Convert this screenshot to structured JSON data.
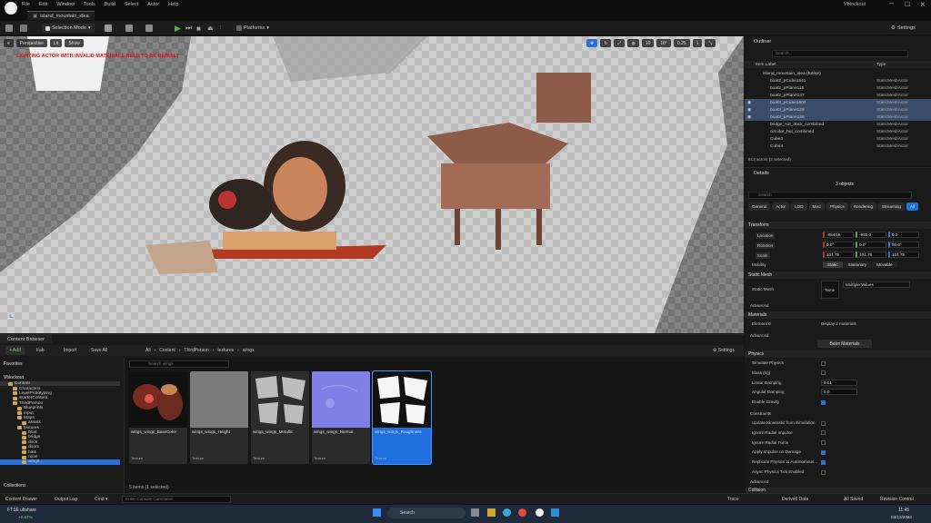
{
  "window": {
    "menu": [
      "File",
      "Edit",
      "Window",
      "Tools",
      "Build",
      "Select",
      "Actor",
      "Help"
    ],
    "tab_title": "island_mountain_idea",
    "project": "Vblockout",
    "min": "─",
    "max": "☐",
    "close": "✕"
  },
  "toolbar": {
    "mode": "Selection Mode",
    "platforms": "Platforms",
    "settings": "Settings"
  },
  "viewport": {
    "perspective": "Perspective",
    "lit": "Lit",
    "show": "Show",
    "warning": "LIGHTING ACTOR WITH INVALID MATERIALS NEED TO BE REBUILT",
    "grid": "10",
    "angle": "10°",
    "scale": "0.25",
    "speed": "1"
  },
  "content_browser": {
    "tab": "Content Browser",
    "add": "+ Add",
    "fab": "Fab",
    "import": "Import",
    "save_all": "Save All",
    "path": [
      "All",
      "Content",
      "ThirdPerson",
      "textures",
      "wings"
    ],
    "settings": "Settings",
    "favorites": "Favorites",
    "project_root": "Vblockout",
    "search_placeholder": "Search wings",
    "tree": [
      {
        "label": "Content",
        "depth": 1
      },
      {
        "label": "Characters",
        "depth": 2
      },
      {
        "label": "LevelPrototyping",
        "depth": 2
      },
      {
        "label": "StarterContent",
        "depth": 2
      },
      {
        "label": "ThirdPerson",
        "depth": 2
      },
      {
        "label": "Blueprints",
        "depth": 3
      },
      {
        "label": "Input",
        "depth": 3
      },
      {
        "label": "Maps",
        "depth": 3
      },
      {
        "label": "assets",
        "depth": 4
      },
      {
        "label": "textures",
        "depth": 3
      },
      {
        "label": "boat",
        "depth": 4
      },
      {
        "label": "bridge",
        "depth": 4
      },
      {
        "label": "dock",
        "depth": 4
      },
      {
        "label": "doors",
        "depth": 4
      },
      {
        "label": "hats",
        "depth": 4
      },
      {
        "label": "ruins",
        "depth": 4
      },
      {
        "label": "wings",
        "depth": 4
      }
    ],
    "collections": "Collections",
    "items": [
      {
        "name": "wings_wings_BaseColor",
        "type": "Texture",
        "thumb": "basecolor"
      },
      {
        "name": "wings_wings_Height",
        "type": "Texture",
        "thumb": "height"
      },
      {
        "name": "wings_wings_Metallic",
        "type": "Texture",
        "thumb": "metallic"
      },
      {
        "name": "wings_wings_Normal",
        "type": "Texture",
        "thumb": "normal"
      },
      {
        "name": "wings_wings_Roughness",
        "type": "Texture",
        "thumb": "roughness"
      }
    ],
    "count": "5 items (1 selected)"
  },
  "outliner": {
    "title": "Outliner",
    "search_placeholder": "Search...",
    "col_label": "Item Label",
    "col_type": "Type",
    "rows": [
      {
        "label": "island_mountain_idea (Editor)",
        "type": "",
        "selected": false,
        "indent": 1
      },
      {
        "label": "boat2_pCube1541",
        "type": "StaticMeshActor",
        "selected": false,
        "indent": 2
      },
      {
        "label": "boat2_pPlane115",
        "type": "StaticMeshActor",
        "selected": false,
        "indent": 2
      },
      {
        "label": "boat2_pPlane147",
        "type": "StaticMeshActor",
        "selected": false,
        "indent": 2
      },
      {
        "label": "boat3_pCube1604",
        "type": "StaticMeshActor",
        "selected": true,
        "indent": 2
      },
      {
        "label": "boat3_pPlane128",
        "type": "StaticMeshActor",
        "selected": true,
        "indent": 2
      },
      {
        "label": "boat3_pPlane148",
        "type": "StaticMeshActor",
        "selected": true,
        "indent": 2
      },
      {
        "label": "bridge_not_dock_combined",
        "type": "StaticMeshActor",
        "selected": false,
        "indent": 2
      },
      {
        "label": "circular_hut_combined",
        "type": "StaticMeshActor",
        "selected": false,
        "indent": 2
      },
      {
        "label": "Cube3",
        "type": "StaticMeshActor",
        "selected": false,
        "indent": 2
      },
      {
        "label": "Cube4",
        "type": "StaticMeshActor",
        "selected": false,
        "indent": 2
      }
    ],
    "footer": "913 actors (3 selected)"
  },
  "details": {
    "title": "Details",
    "objects": "3 objects",
    "search_placeholder": "Search",
    "tabs": [
      "General",
      "Actor",
      "LOD",
      "Misc",
      "Physics",
      "Rendering",
      "Streaming",
      "All"
    ],
    "transform": "Transform",
    "location": {
      "label": "Location",
      "x": "-8840.6",
      "y": "-980.0",
      "z": "0.0"
    },
    "rotation": {
      "label": "Rotation",
      "x": "0.0°",
      "y": "0.0°",
      "z": "90.0°"
    },
    "scale": {
      "label": "Scale",
      "x": "101.75",
      "y": "101.75",
      "z": "101.75"
    },
    "mobility": {
      "label": "Mobility",
      "options": [
        "Static",
        "Stationary",
        "Movable"
      ]
    },
    "static_mesh_section": "Static Mesh",
    "static_mesh_label": "Static Mesh",
    "mesh_none": "None",
    "mesh_value": "Multiple Values",
    "advanced": "Advanced",
    "materials_section": "Materials",
    "element": "Element 0",
    "element_value": "Display 2 materials",
    "bake": "Bake Materials",
    "physics_section": "Physics",
    "physics": [
      {
        "label": "Simulate Physics",
        "on": false
      },
      {
        "label": "Mass (kg)",
        "on": false
      },
      {
        "label": "Linear Damping",
        "value": "0.01"
      },
      {
        "label": "Angular Damping",
        "value": "0.0"
      },
      {
        "label": "Enable Gravity",
        "on": true
      }
    ],
    "constraints": "Constraints",
    "physics2": [
      {
        "label": "Update Kinematic from Simulation",
        "on": false
      },
      {
        "label": "Ignore Radial Impulse",
        "on": false
      },
      {
        "label": "Ignore Radial Force",
        "on": false
      },
      {
        "label": "Apply Impulse on Damage",
        "on": true
      },
      {
        "label": "Replicate Physics to Autonomous...",
        "on": true
      },
      {
        "label": "Async Physics Tick Enabled",
        "on": false
      }
    ],
    "collision": "Collision"
  },
  "status": {
    "content_drawer": "Content Drawer",
    "output_log": "Output Log",
    "cmd": "Cmd",
    "console_placeholder": "Enter Console Command",
    "trace": "Trace",
    "derived": "Derived Data",
    "saved": "All Saved",
    "revision": "Revision Control"
  },
  "taskbar": {
    "ticker": "FTSE ultshare",
    "ticker_change": "+0.67%",
    "search": "Search",
    "time": "11:45",
    "date": "03/12/2024"
  },
  "colors": {
    "accent": "#1f6fe0",
    "selection": "#3a4d6b",
    "play_green": "#49b84a",
    "folder": "#c7a95a",
    "warning": "#dd1111"
  }
}
